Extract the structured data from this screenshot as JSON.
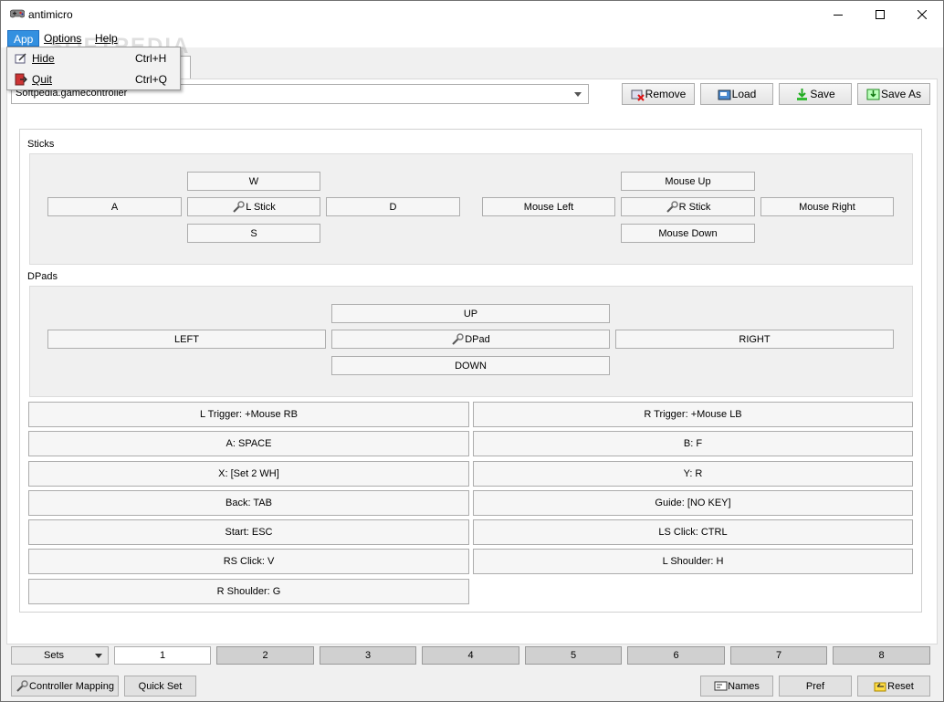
{
  "window": {
    "title": "antimicro"
  },
  "menu": {
    "items": [
      "App",
      "Options",
      "Help"
    ],
    "app_dropdown": [
      {
        "label": "Hide",
        "shortcut": "Ctrl+H",
        "icon": "hide-icon"
      },
      {
        "label": "Quit",
        "shortcut": "Ctrl+Q",
        "icon": "quit-icon"
      }
    ]
  },
  "watermark": "SOFTPEDIA",
  "profile": {
    "selected": "Softpedia.gamecontroller"
  },
  "toolbar": {
    "remove": "Remove",
    "load": "Load",
    "save": "Save",
    "save_as": "Save As"
  },
  "sticks": {
    "label": "Sticks",
    "left": {
      "up": "W",
      "left": "A",
      "center": "L Stick",
      "right": "D",
      "down": "S"
    },
    "right": {
      "up": "Mouse Up",
      "left": "Mouse Left",
      "center": "R Stick",
      "right": "Mouse Right",
      "down": "Mouse Down"
    }
  },
  "dpads": {
    "label": "DPads",
    "up": "UP",
    "left": "LEFT",
    "center": "DPad",
    "right": "RIGHT",
    "down": "DOWN"
  },
  "mappings": [
    "L Trigger: +Mouse RB",
    "R Trigger: +Mouse LB",
    "A: SPACE",
    "B: F",
    "X: [Set 2 WH]",
    "Y: R",
    "Back: TAB",
    "Guide: [NO KEY]",
    "Start: ESC",
    "LS Click: CTRL",
    "RS Click: V",
    "L Shoulder: H",
    "R Shoulder: G"
  ],
  "sets": {
    "label": "Sets",
    "numbers": [
      "1",
      "2",
      "3",
      "4",
      "5",
      "6",
      "7",
      "8"
    ],
    "active_index": 0
  },
  "bottom": {
    "controller_mapping": "Controller Mapping",
    "quick_set": "Quick Set",
    "names": "Names",
    "pref": "Pref",
    "reset": "Reset"
  },
  "colors": {
    "menu_active": "#3390e0",
    "panel_bg": "#f0f0f0",
    "button_bg": "#e1e1e1"
  }
}
